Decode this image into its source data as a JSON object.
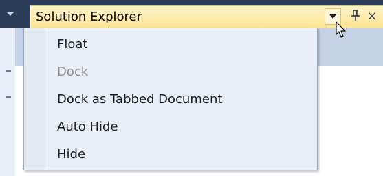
{
  "window": {
    "title": "Solution Explorer",
    "pin_glyph": "&#x4A5;",
    "close_glyph": "×"
  },
  "menu": {
    "items": [
      {
        "label": "Float",
        "enabled": true
      },
      {
        "label": "Dock",
        "enabled": false
      },
      {
        "label": "Dock as Tabbed Document",
        "enabled": true
      },
      {
        "label": "Auto Hide",
        "enabled": true
      },
      {
        "label": "Hide",
        "enabled": true
      }
    ]
  },
  "colors": {
    "chrome": "#2b3c59",
    "title_bar": "#ffe493",
    "menu_bg": "#e9edf5",
    "disabled_text": "#8f8f8f"
  },
  "icons": [
    "window-position-dropdown-icon",
    "pin-icon",
    "close-icon",
    "mouse-cursor-icon"
  ]
}
